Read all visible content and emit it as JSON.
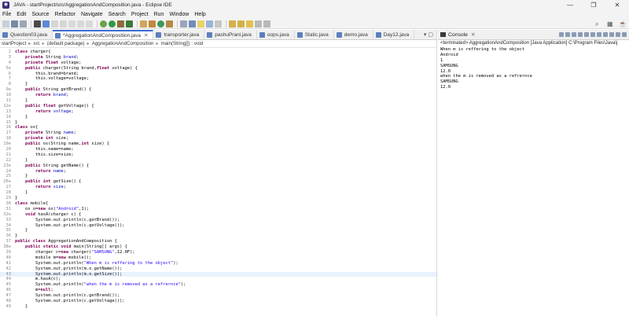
{
  "window": {
    "title": "JAVA - startProject/src/AggregationAndComposition.java - Eclipse IDE",
    "icons": {
      "minimize": "minimize-icon",
      "maximize": "maximize-icon",
      "close": "close-icon"
    }
  },
  "menu": [
    "File",
    "Edit",
    "Source",
    "Refactor",
    "Navigate",
    "Search",
    "Project",
    "Run",
    "Window",
    "Help"
  ],
  "editor_tabs": [
    {
      "label": "Question03.java",
      "active": false
    },
    {
      "label": "*AggregationAndComposition.java",
      "active": true
    },
    {
      "label": "transporter.java",
      "active": false
    },
    {
      "label": "pashuPrani.java",
      "active": false
    },
    {
      "label": "oops.java",
      "active": false
    },
    {
      "label": "Static.java",
      "active": false
    },
    {
      "label": "demo.java",
      "active": false
    },
    {
      "label": "Day12.java",
      "active": false
    }
  ],
  "breadcrumb": [
    "startProject",
    "src",
    "(default package)",
    "AggregationAndComposition",
    "main(String[]) : void"
  ],
  "code": {
    "highlighted_line": "43",
    "lines": [
      {
        "n": "2",
        "text": "class charger{"
      },
      {
        "n": "3",
        "text": "    private String brand;"
      },
      {
        "n": "4",
        "text": "    private float voltage;"
      },
      {
        "n": "5⊖",
        "text": "    public charger(String brand,float voltage) {"
      },
      {
        "n": "6",
        "text": "        this.brand=brand;"
      },
      {
        "n": "7",
        "text": "        this.voltage=voltage;"
      },
      {
        "n": "8",
        "text": "    }"
      },
      {
        "n": "9⊖",
        "text": "    public String getBrand() {"
      },
      {
        "n": "10",
        "text": "        return brand;"
      },
      {
        "n": "11",
        "text": "    }"
      },
      {
        "n": "12⊖",
        "text": "    public float getVoltage() {"
      },
      {
        "n": "13",
        "text": "        return voltage;"
      },
      {
        "n": "14",
        "text": "    }"
      },
      {
        "n": "15",
        "text": "}"
      },
      {
        "n": "16",
        "text": "class os{"
      },
      {
        "n": "17",
        "text": "    private String name;"
      },
      {
        "n": "18",
        "text": "    private int size;"
      },
      {
        "n": "19⊖",
        "text": "    public os(String name,int size) {"
      },
      {
        "n": "20",
        "text": "        this.name=name;"
      },
      {
        "n": "21",
        "text": "        this.size=size;"
      },
      {
        "n": "22",
        "text": "    }"
      },
      {
        "n": "23⊖",
        "text": "    public String getName() {"
      },
      {
        "n": "24",
        "text": "        return name;"
      },
      {
        "n": "25",
        "text": "    }"
      },
      {
        "n": "26⊖",
        "text": "    public int getSize() {"
      },
      {
        "n": "27",
        "text": "        return size;"
      },
      {
        "n": "28",
        "text": "    }"
      },
      {
        "n": "29",
        "text": "}"
      },
      {
        "n": "30",
        "text": "class mobile{"
      },
      {
        "n": "31",
        "text": "    os o=new os(\"Android\",1);"
      },
      {
        "n": "32⊖",
        "text": "    void hasA(charger c) {"
      },
      {
        "n": "33",
        "text": "        System.out.println(c.getBrand());"
      },
      {
        "n": "34",
        "text": "        System.out.println(c.getVoltage());"
      },
      {
        "n": "35",
        "text": "    }"
      },
      {
        "n": "36",
        "text": "}"
      },
      {
        "n": "37",
        "text": "public class AggregationAndComposition {"
      },
      {
        "n": "38⊖",
        "text": "    public static void main(String[] args) {"
      },
      {
        "n": "39",
        "text": "        charger c=new charger(\"SAMSUNG\",12.0F);"
      },
      {
        "n": "40",
        "text": "        mobile m=new mobile();"
      },
      {
        "n": "41",
        "text": "        System.out.println(\"When m is reffering to the object\");"
      },
      {
        "n": "42",
        "text": "        System.out.println(m.o.getName());"
      },
      {
        "n": "43",
        "text": "        System.out.println(m.o.getSize());"
      },
      {
        "n": "44",
        "text": "        m.hasA(c);"
      },
      {
        "n": "45",
        "text": "        System.out.println(\"when the m is removed as a refrernce\");"
      },
      {
        "n": "46",
        "text": "        m=null;"
      },
      {
        "n": "47",
        "text": "        System.out.println(c.getBrand());"
      },
      {
        "n": "48",
        "text": "        System.out.println(c.getVoltage());"
      },
      {
        "n": "49",
        "text": "    }"
      }
    ]
  },
  "console": {
    "tab_label": "Console",
    "status": "<terminated> AggregationAndComposition [Java Application] C:\\Program Files\\Java\\j",
    "output": [
      "When m is reffering to the object",
      "Android",
      "1",
      "SAMSUNG",
      "12.0",
      "when the m is removed as a refrernce",
      "SAMSUNG",
      "12.0"
    ]
  },
  "colors": {
    "keyword": "#7f0055",
    "field": "#0000c0",
    "string": "#2a00ff",
    "active_tab": "#3c6fd1",
    "current_line": "#e8f2fe"
  }
}
